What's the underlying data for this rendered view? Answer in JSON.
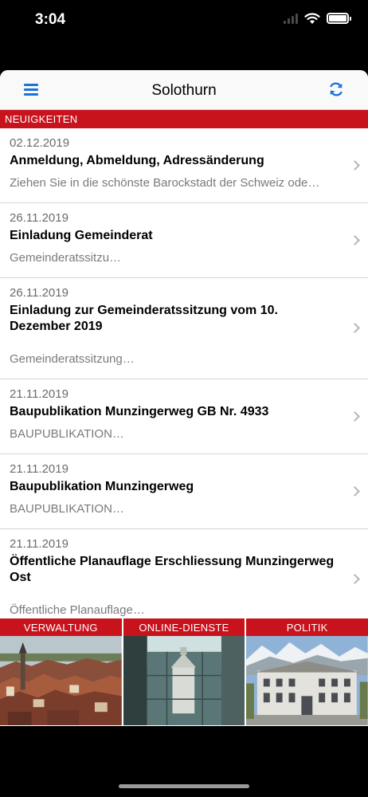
{
  "status": {
    "time": "3:04"
  },
  "nav": {
    "title": "Solothurn",
    "menu_icon": "hamburger-menu-icon",
    "refresh_icon": "refresh-icon"
  },
  "section": {
    "header": "NEUIGKEITEN"
  },
  "news": [
    {
      "date": "02.12.2019",
      "title": "Anmeldung, Abmeldung, Adressänderung",
      "snippet": "Ziehen Sie in die schönste Barockstadt der Schweiz ode…"
    },
    {
      "date": "26.11.2019",
      "title": "Einladung Gemeinderat",
      "snippet": "Gemeinderatssitzu…"
    },
    {
      "date": "26.11.2019",
      "title": "Einladung zur Gemeinderatssitzung vom 10. Dezember 2019",
      "snippet": "Gemeinderatssitzung…"
    },
    {
      "date": "21.11.2019",
      "title": "Baupublikation Munzingerweg GB Nr. 4933",
      "snippet": "BAUPUBLIKATION…"
    },
    {
      "date": "21.11.2019",
      "title": "Baupublikation Munzingerweg",
      "snippet": "BAUPUBLIKATION…"
    },
    {
      "date": "21.11.2019",
      "title": "Öffentliche Planauflage Erschliessung Munzingerweg Ost",
      "snippet": "Öffentliche Planauflage…"
    }
  ],
  "tiles": [
    {
      "label": "VERWALTUNG"
    },
    {
      "label": "ONLINE-DIENSTE"
    },
    {
      "label": "POLITIK"
    }
  ],
  "colors": {
    "accent_red": "#c8131d",
    "tint_blue": "#1a73d9"
  }
}
